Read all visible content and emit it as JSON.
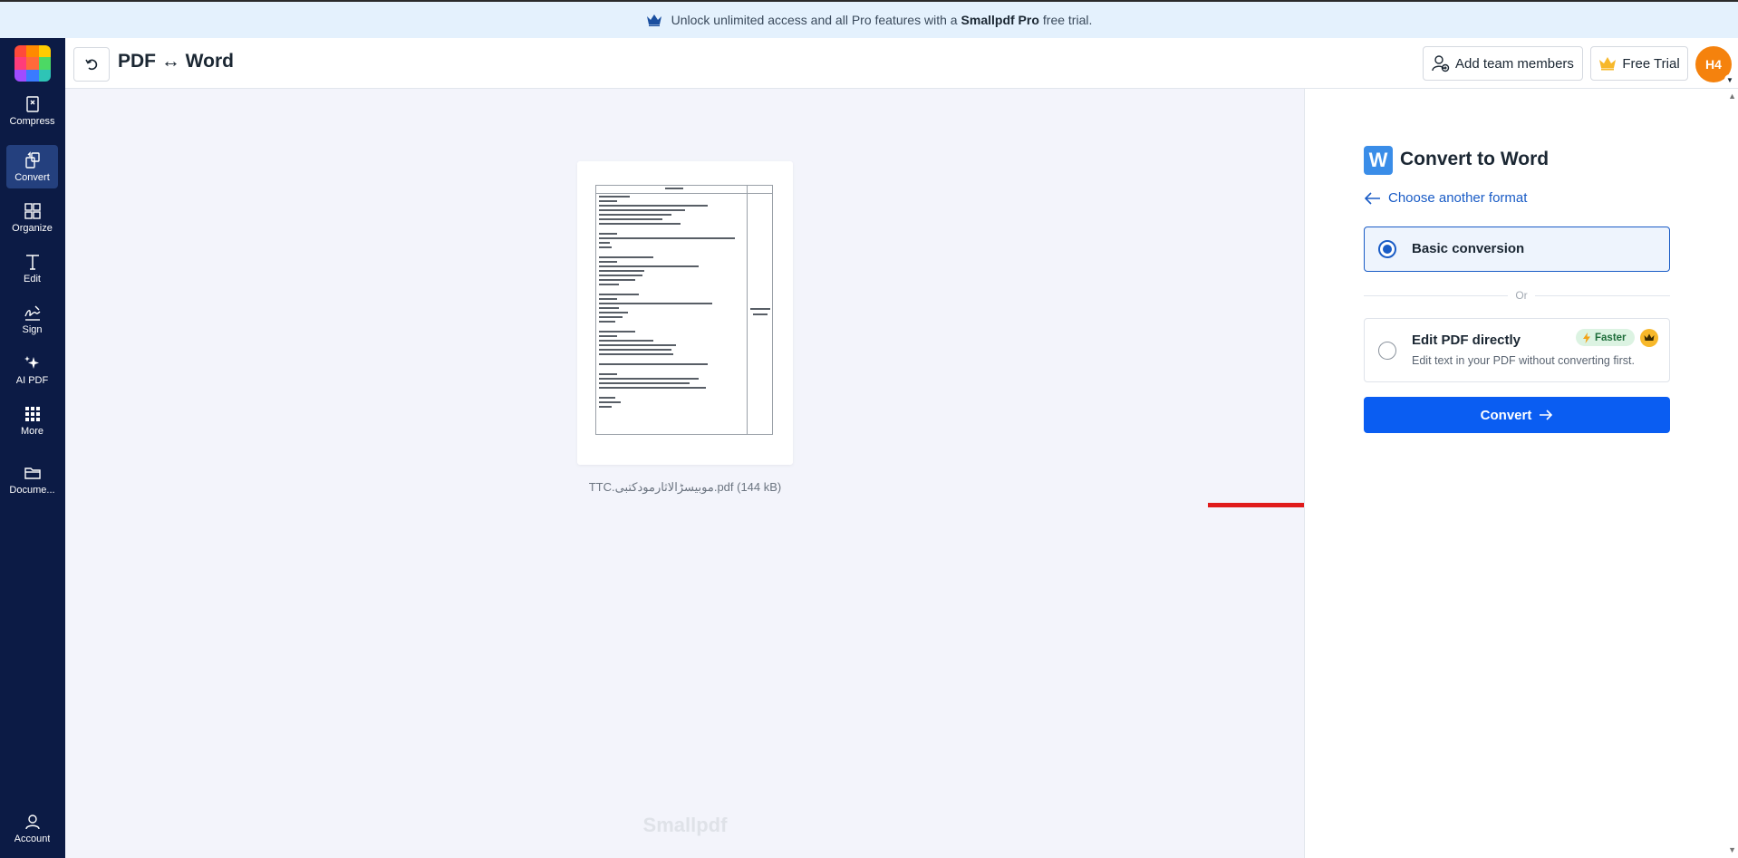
{
  "banner": {
    "text_before": "Unlock unlimited access and all Pro features with a",
    "brand": "Smallpdf Pro",
    "text_after": "free trial.",
    "icon": "crown-icon"
  },
  "colors": {
    "sidebar_bg": "#0c1b45",
    "sidebar_active": "#24407e",
    "primary": "#0a5df2",
    "link": "#1a5cc6",
    "avatar": "#f5820d",
    "annotation_arrow": "#e01b1b"
  },
  "sidebar": {
    "items": [
      {
        "label": "Compress",
        "icon": "compress-icon"
      },
      {
        "label": "Convert",
        "icon": "convert-icon",
        "active": true
      },
      {
        "label": "Organize",
        "icon": "organize-icon"
      },
      {
        "label": "Edit",
        "icon": "edit-text-icon"
      },
      {
        "label": "Sign",
        "icon": "signature-icon"
      },
      {
        "label": "AI PDF",
        "icon": "ai-sparkle-icon"
      },
      {
        "label": "More",
        "icon": "grid-dots-icon"
      },
      {
        "label": "Docume...",
        "icon": "folder-icon"
      }
    ],
    "account": {
      "label": "Account",
      "icon": "user-icon"
    }
  },
  "topbar": {
    "title": "PDF ↔ Word",
    "undo_icon": "undo-icon",
    "add_team": "Add team members",
    "free_trial": "Free Trial",
    "avatar": "H4"
  },
  "document": {
    "file_name": "TTC.موبیسڑالاثارمودکتبی.pdf (144 kB)"
  },
  "watermark": "Smallpdf",
  "panel": {
    "title": "Convert to Word",
    "w_icon": "W",
    "back_link": "Choose another format",
    "options": [
      {
        "label": "Basic conversion",
        "selected": true
      },
      {
        "label": "Edit PDF directly",
        "description": "Edit text in your PDF without converting first.",
        "badge": "Faster",
        "selected": false
      }
    ],
    "divider": "Or",
    "convert_button": "Convert"
  }
}
